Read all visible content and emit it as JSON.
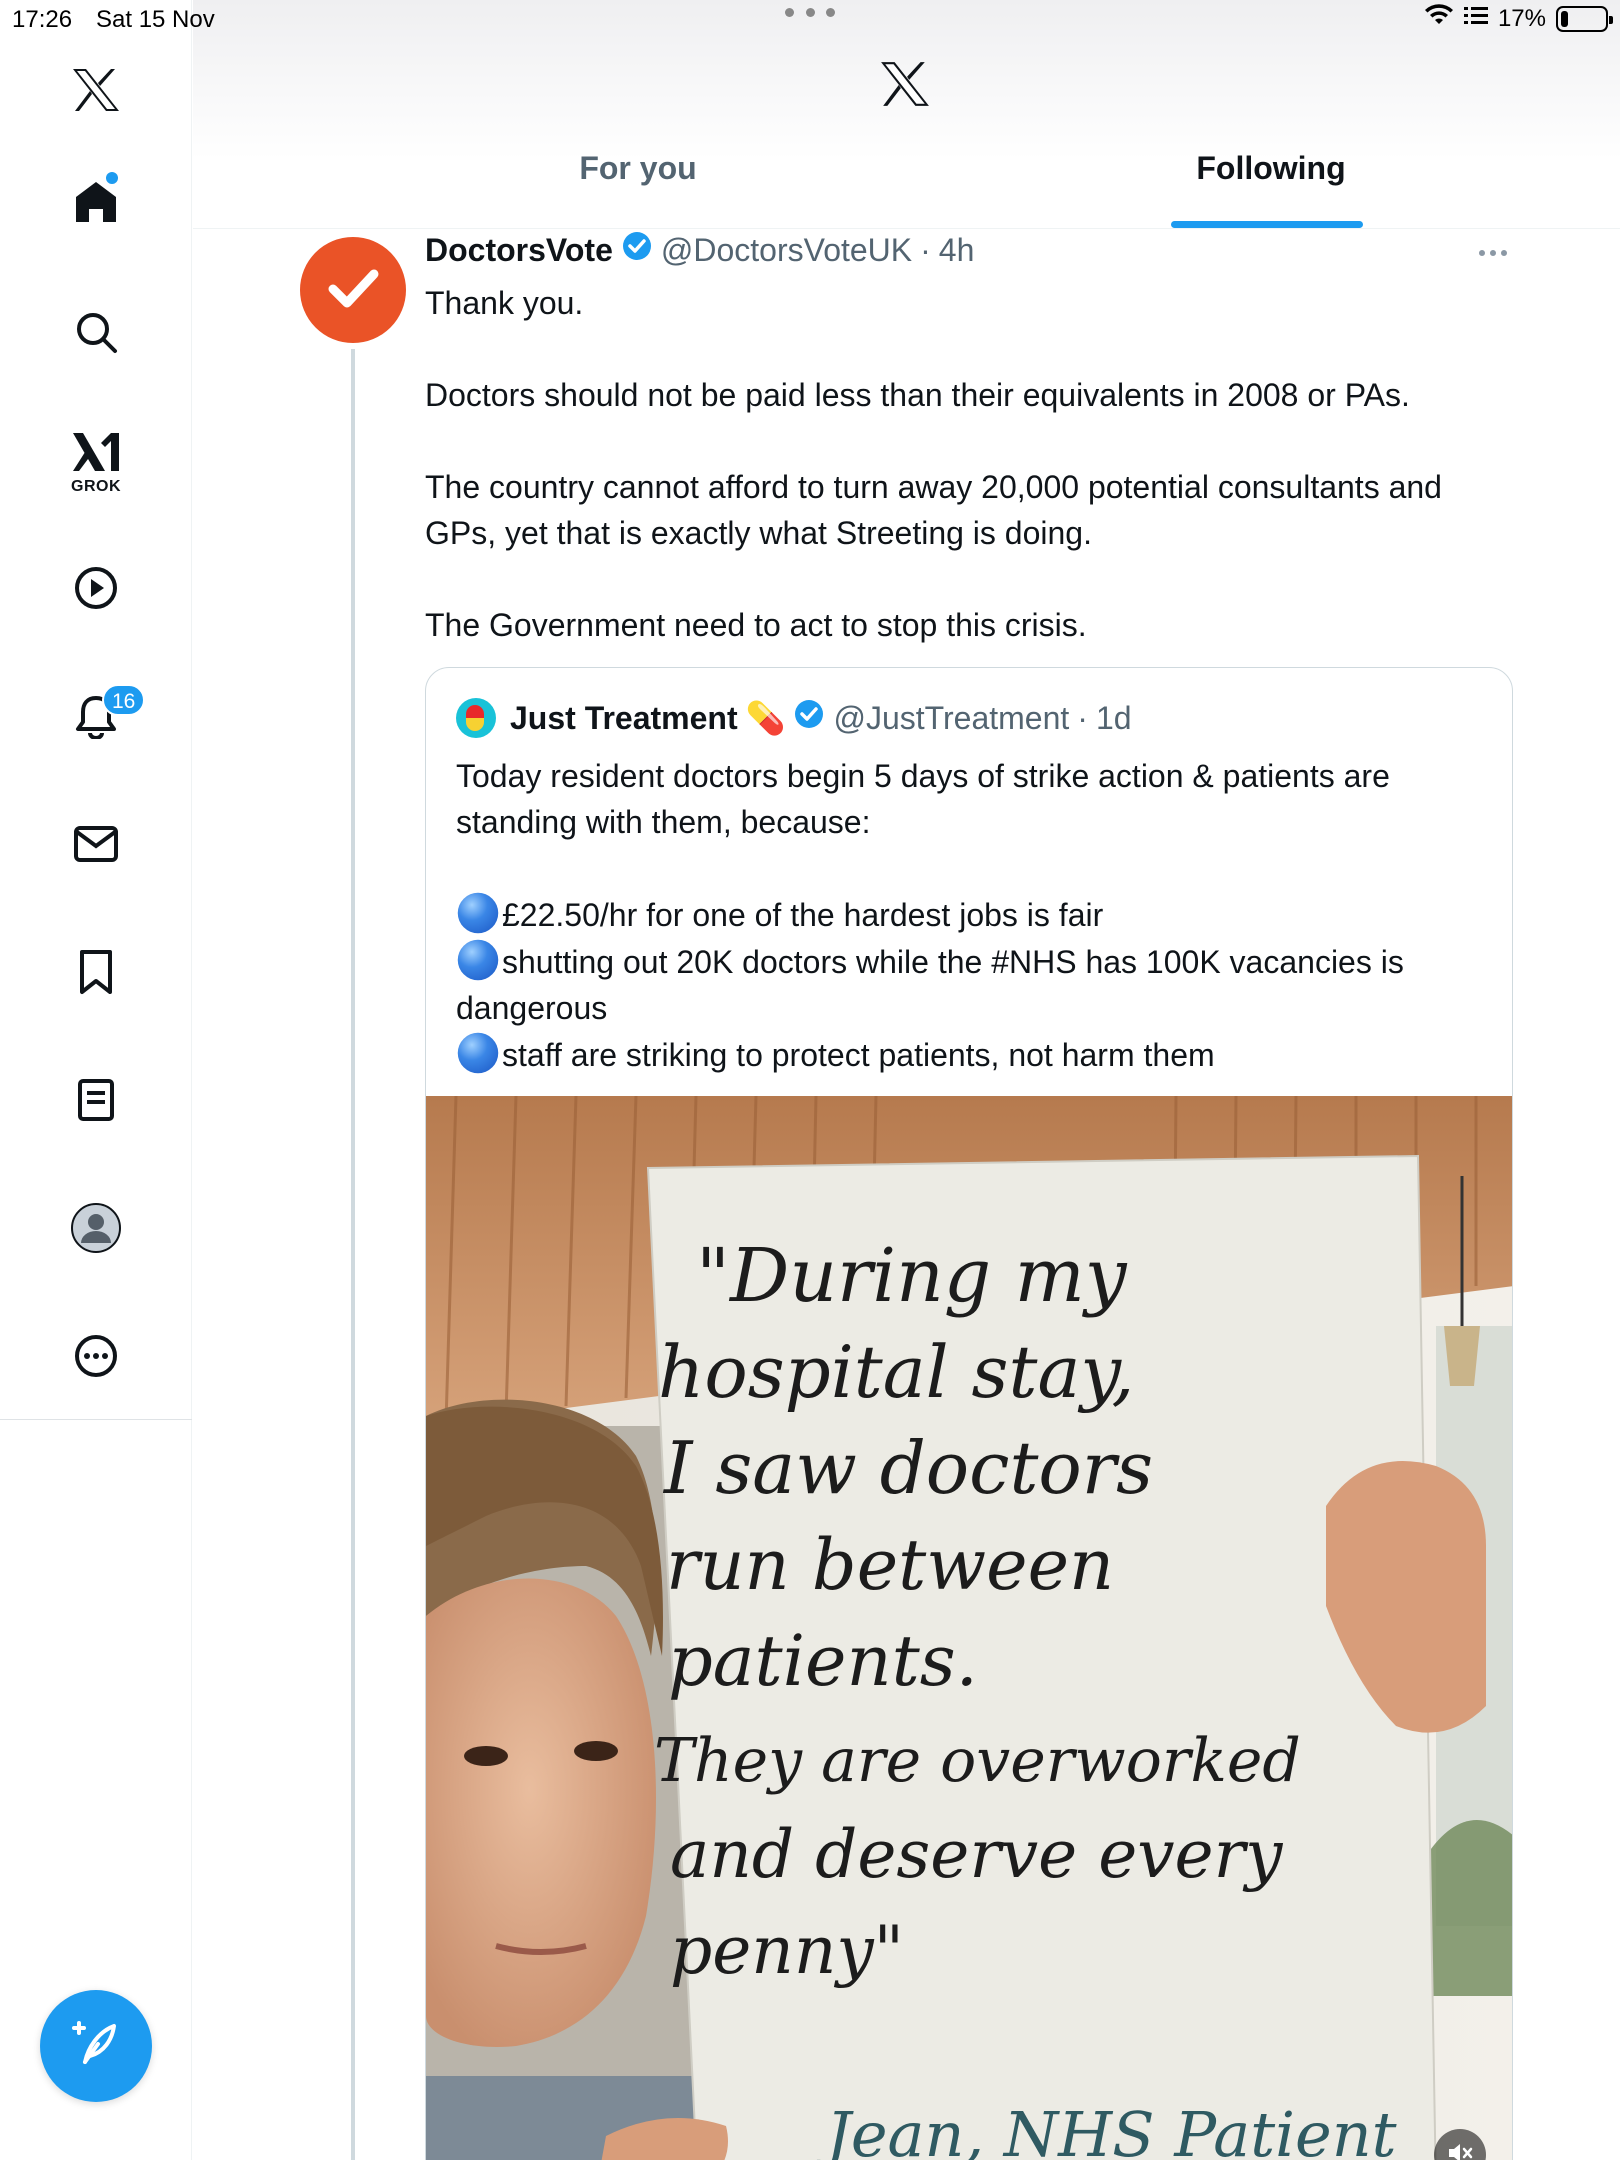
{
  "status_bar": {
    "time": "17:26",
    "date": "Sat 15 Nov",
    "battery_percent": "17%",
    "battery_level": 0.17
  },
  "sidebar": {
    "items": [
      {
        "id": "logo",
        "icon": "x-logo-icon"
      },
      {
        "id": "home",
        "icon": "home-icon"
      },
      {
        "id": "explore",
        "icon": "search-icon"
      },
      {
        "id": "grok",
        "icon": "grok-icon",
        "label": "GROK"
      },
      {
        "id": "video",
        "icon": "play-icon"
      },
      {
        "id": "notifications",
        "icon": "bell-icon",
        "badge": "16"
      },
      {
        "id": "messages",
        "icon": "mail-icon"
      },
      {
        "id": "bookmarks",
        "icon": "bookmark-icon"
      },
      {
        "id": "lists",
        "icon": "list-icon"
      },
      {
        "id": "profile",
        "icon": "profile-icon"
      },
      {
        "id": "more",
        "icon": "more-circle-icon"
      }
    ],
    "compose_icon": "compose-icon"
  },
  "header": {
    "logo_icon": "x-logo-icon",
    "tabs": [
      {
        "label": "For you",
        "active": false
      },
      {
        "label": "Following",
        "active": true
      }
    ],
    "accent_color": "#1d9bf0"
  },
  "tweet": {
    "author_name": "DoctorsVote",
    "verified": true,
    "handle": "@DoctorsVoteUK",
    "time": "4h",
    "avatar_color": "#ea5327",
    "text": [
      "Thank you.",
      "Doctors should not be paid less than their equivalents in 2008 or PAs.",
      "The country cannot afford to turn away 20,000 potential consultants and GPs, yet that is exactly what Streeting is doing.",
      "The Government need to act to stop this crisis."
    ]
  },
  "quote": {
    "author_name": "Just Treatment",
    "emoji": "💊",
    "verified": true,
    "handle": "@JustTreatment",
    "time": "1d",
    "intro": "Today resident doctors begin 5 days of strike action & patients are standing with them, because:",
    "bullets": [
      "£22.50/hr for one of the hardest jobs is fair",
      "shutting out 20K doctors while the #NHS has 100K vacancies is dangerous",
      "staff are striking to protect patients, not harm them"
    ],
    "media": {
      "sign_lines": [
        "\"During my",
        "hospital stay,",
        "I saw doctors",
        "run between",
        "patients.",
        "They are overworked",
        "and deserve every",
        "penny\""
      ],
      "sign_signature": "Jean, NHS Patient",
      "mute_icon": "mute-icon"
    }
  }
}
